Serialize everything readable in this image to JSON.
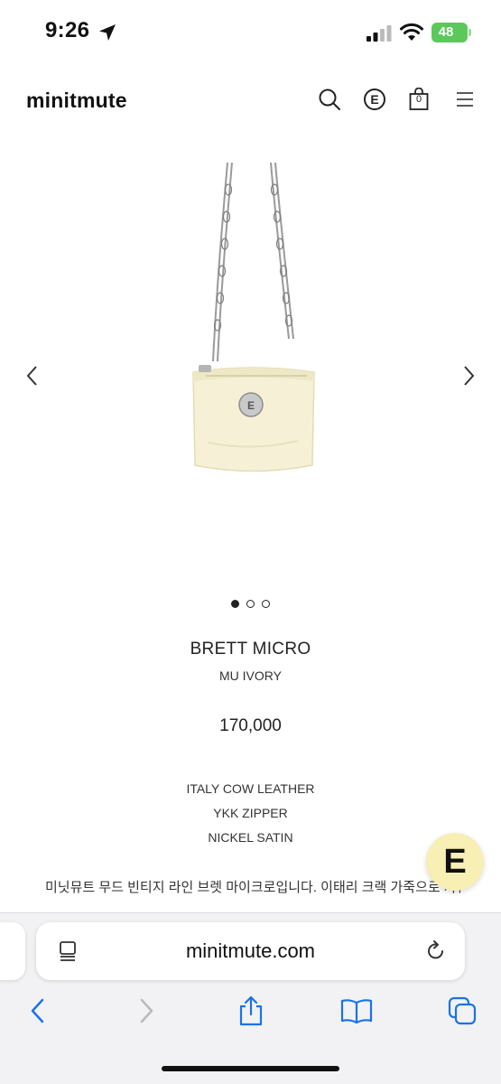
{
  "status_bar": {
    "time": "9:26",
    "battery": "48",
    "location_icon": "location-arrow-icon",
    "signal_icon": "cellular-signal-icon",
    "wifi_icon": "wifi-icon",
    "battery_icon": "battery-charging-icon"
  },
  "header": {
    "logo": "minitmute",
    "e_label": "E",
    "cart_count": "0",
    "icons": [
      "search-icon",
      "e-circle-icon",
      "shopping-bag-icon",
      "hamburger-menu-icon"
    ]
  },
  "gallery": {
    "slide_count": 3,
    "active_slide": 1,
    "prev_icon": "chevron-left-icon",
    "next_icon": "chevron-right-icon",
    "bag_color": "#f6f1d6"
  },
  "product": {
    "name": "BRETT MICRO",
    "color": "MU IVORY",
    "price": "170,000",
    "specs": [
      "ITALY COW LEATHER",
      "YKK ZIPPER",
      "NICKEL SATIN"
    ],
    "description": "미닛뮤트 무드 빈티지 라인 브렛 마이크로입니다. 이태리 크랙 가죽으로 자연스러운 광도와 불규칙한 주름으로 한층 고급스러운 질감을 표현한"
  },
  "chat_button": {
    "letter": "E",
    "icon": "chat-e-icon",
    "background": "#f7efb3"
  },
  "safari": {
    "url": "minitmute.com",
    "page_menu_icon": "page-menu-icon",
    "reload_icon": "reload-icon",
    "toolbar": [
      "back-icon",
      "forward-icon",
      "share-icon",
      "bookmarks-icon",
      "tabs-icon"
    ],
    "accent": "#1a73e8"
  }
}
